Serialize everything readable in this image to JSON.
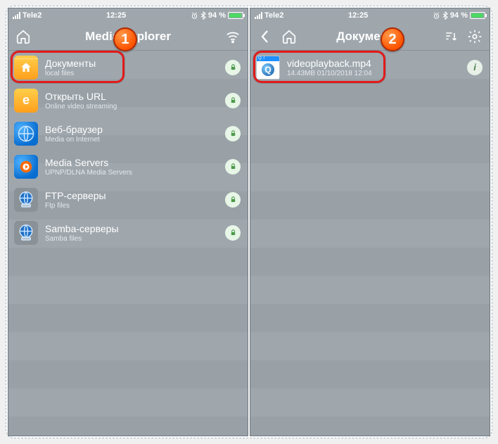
{
  "status": {
    "carrier": "Tele2",
    "time": "12:25",
    "battery_pct": "94 %",
    "bluetooth": "*"
  },
  "left": {
    "title": "Media Explorer",
    "items": [
      {
        "title": "Документы",
        "sub": "local files",
        "icon": "folder"
      },
      {
        "title": "Открыть URL",
        "sub": "Online video streaming",
        "icon": "e"
      },
      {
        "title": "Веб-браузер",
        "sub": "Media on Internet",
        "icon": "globe"
      },
      {
        "title": "Media Servers",
        "sub": "UPNP/DLNA Media Servers",
        "icon": "media"
      },
      {
        "title": "FTP-серверы",
        "sub": "Ftp files",
        "icon": "ftp"
      },
      {
        "title": "Samba-серверы",
        "sub": "Samba files",
        "icon": "smb"
      }
    ]
  },
  "right": {
    "title": "Документы",
    "file": {
      "name": "videoplayback.mp4",
      "meta": "14.43MB   01/10/2018 12:04",
      "qt": "Q.T"
    }
  },
  "callouts": {
    "one": "1",
    "two": "2"
  }
}
